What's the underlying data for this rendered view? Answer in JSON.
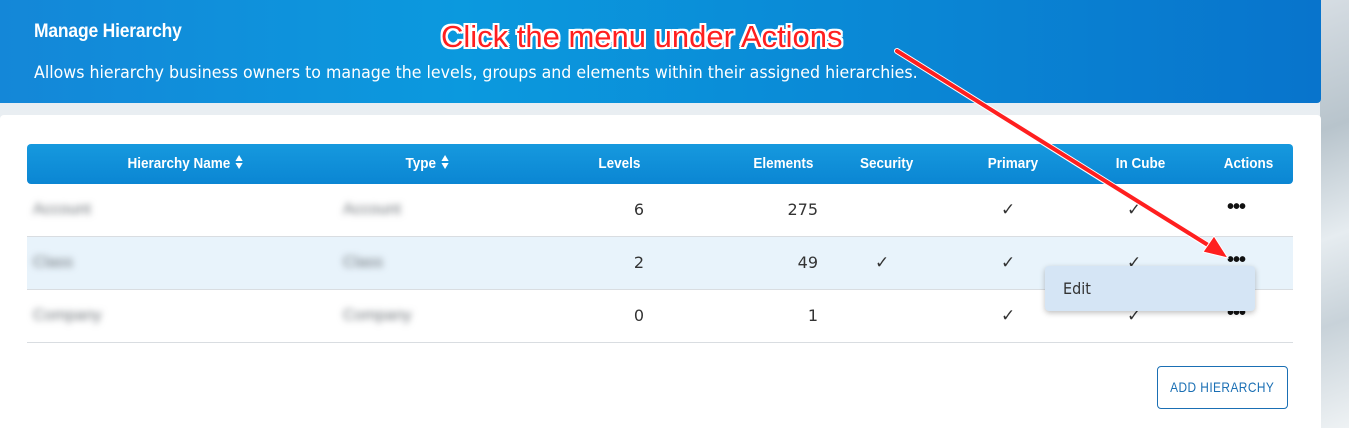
{
  "header": {
    "title": "Manage Hierarchy",
    "subtitle": "Allows hierarchy business owners to manage the levels, groups and elements within their assigned hierarchies."
  },
  "annotation": {
    "text": "Click the menu under Actions",
    "color": "#ff1f1f"
  },
  "table": {
    "columns": [
      "Hierarchy Name",
      "Type",
      "Levels",
      "Elements",
      "Security",
      "Primary",
      "In Cube",
      "Actions"
    ],
    "check_glyph": "✓",
    "rows": [
      {
        "name": "Account",
        "type": "Account",
        "levels": "6",
        "elements": "275",
        "security": false,
        "primary": true,
        "in_cube": true
      },
      {
        "name": "Class",
        "type": "Class",
        "levels": "2",
        "elements": "49",
        "security": true,
        "primary": true,
        "in_cube": true
      },
      {
        "name": "Company",
        "type": "Company",
        "levels": "0",
        "elements": "1",
        "security": false,
        "primary": true,
        "in_cube": true
      }
    ]
  },
  "actions_menu": {
    "items": [
      {
        "label": "Edit"
      }
    ]
  },
  "buttons": {
    "add_hierarchy": "ADD HIERARCHY"
  },
  "colors": {
    "accent": "#0b86d3",
    "highlight_row": "#e8f3fb",
    "menu_bg": "#d5e5f5"
  }
}
